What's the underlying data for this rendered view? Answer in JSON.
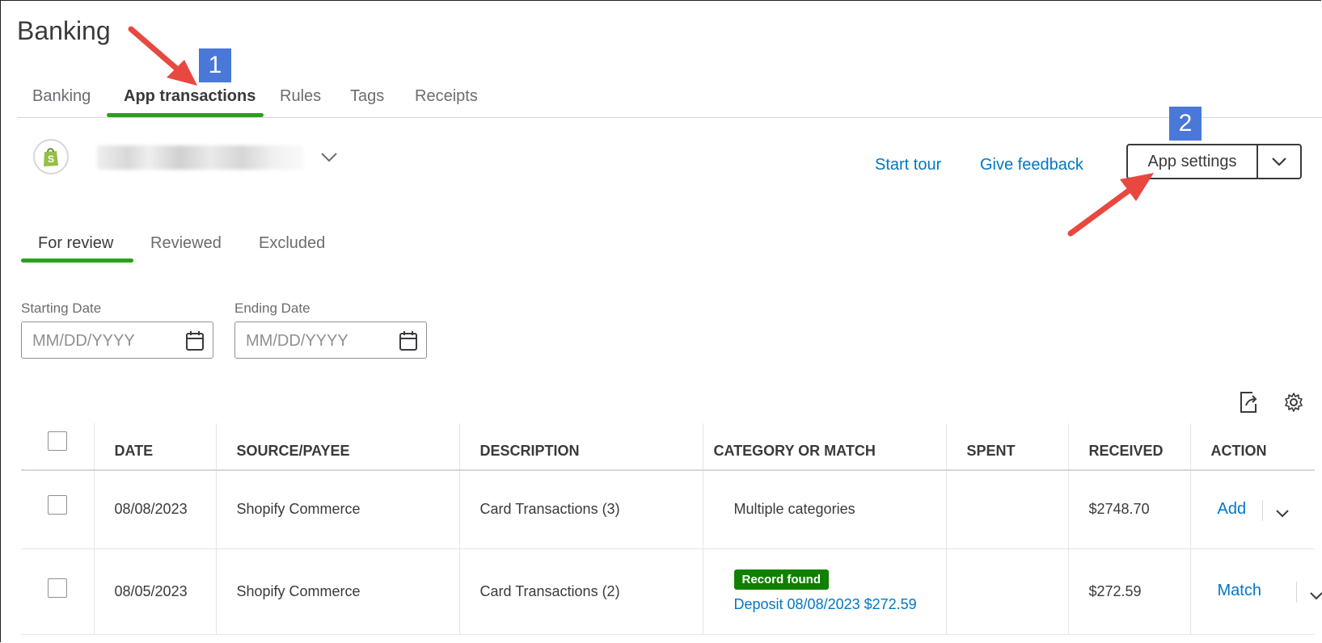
{
  "page": {
    "title": "Banking"
  },
  "tabs": [
    {
      "label": "Banking",
      "active": false
    },
    {
      "label": "App transactions",
      "active": true
    },
    {
      "label": "Rules",
      "active": false
    },
    {
      "label": "Tags",
      "active": false
    },
    {
      "label": "Receipts",
      "active": false
    }
  ],
  "account": {
    "icon": "shopify-bag-icon"
  },
  "header_actions": {
    "start_tour": "Start tour",
    "give_feedback": "Give feedback",
    "app_settings": "App settings"
  },
  "annotations": {
    "badge1": "1",
    "badge2": "2",
    "arrow_color": "#e8483f",
    "badge_color": "#4a78d8"
  },
  "subtabs": [
    {
      "label": "For review",
      "active": true
    },
    {
      "label": "Reviewed",
      "active": false
    },
    {
      "label": "Excluded",
      "active": false
    }
  ],
  "filters": {
    "start": {
      "label": "Starting Date",
      "placeholder": "MM/DD/YYYY"
    },
    "end": {
      "label": "Ending Date",
      "placeholder": "MM/DD/YYYY"
    }
  },
  "table": {
    "columns": [
      "DATE",
      "SOURCE/PAYEE",
      "DESCRIPTION",
      "CATEGORY OR MATCH",
      "SPENT",
      "RECEIVED",
      "ACTION"
    ],
    "rows": [
      {
        "date": "08/08/2023",
        "payee": "Shopify Commerce",
        "description": "Card Transactions (3)",
        "category": "Multiple categories",
        "spent": "",
        "received": "$2748.70",
        "action": "Add"
      },
      {
        "date": "08/05/2023",
        "payee": "Shopify Commerce",
        "description": "Card Transactions (2)",
        "badge": "Record found",
        "match": "Deposit 08/08/2023 $272.59",
        "spent": "",
        "received": "$272.59",
        "action": "Match"
      }
    ]
  },
  "colors": {
    "accent_green": "#2ca01c",
    "link_blue": "#0077c5",
    "record_green": "#108000"
  }
}
